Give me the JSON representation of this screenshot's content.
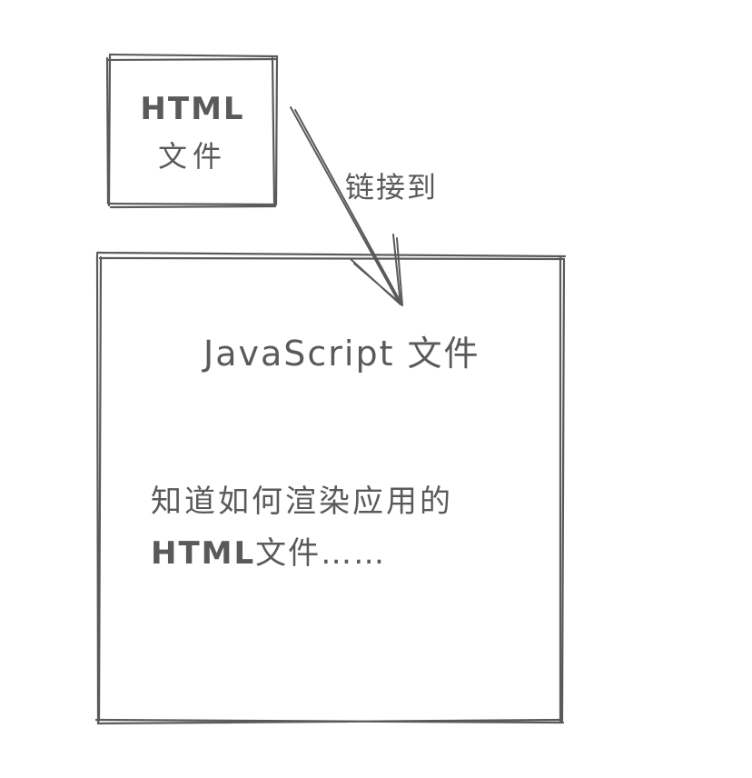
{
  "diagram": {
    "html_box": {
      "line1": "HTML",
      "line2": "文件"
    },
    "arrow": {
      "label": "链接到"
    },
    "js_box": {
      "title": "JavaScript 文件",
      "desc_line1": "知道如何渲染应用的",
      "desc_line2_en": "HTML",
      "desc_line2_rest": "文件……"
    },
    "colors": {
      "stroke": "#5a5a5a",
      "background": "#ffffff"
    }
  }
}
